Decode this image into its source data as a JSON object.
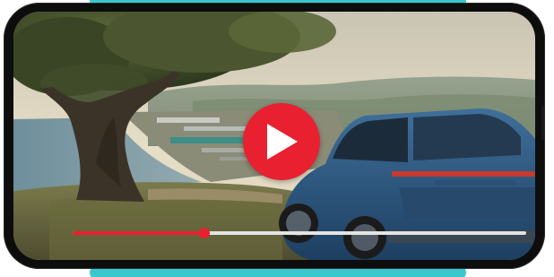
{
  "player": {
    "accent_color": "#e8202f",
    "track_color": "#e4e4e4",
    "play_icon": "play-icon",
    "progress_fraction": 0.29
  },
  "device": {
    "bezel_color": "#0d0d0d",
    "case_accent_color": "#3ac8cf"
  }
}
